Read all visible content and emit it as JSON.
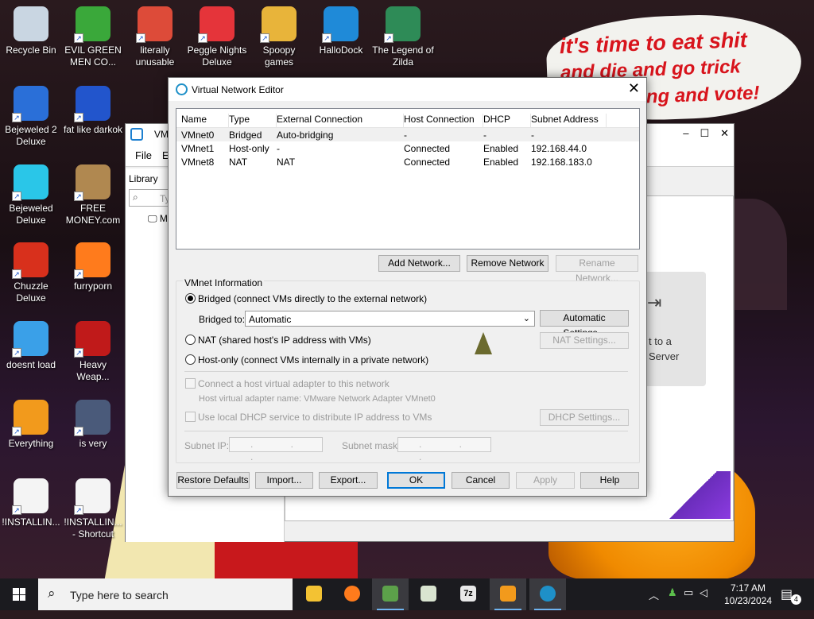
{
  "desktop": {
    "bubble": {
      "line1": "it's time to eat shit",
      "line2": "and die and go trick",
      "line3": "ing and vote!"
    },
    "icons": [
      {
        "label": "Recycle Bin",
        "color": "#c9d6e2"
      },
      {
        "label": "EVIL GREEN MEN CO...",
        "color": "#3aa83a"
      },
      {
        "label": "literally unusable",
        "color": "#dd4b39"
      },
      {
        "label": "Peggle Nights Deluxe",
        "color": "#e5343a"
      },
      {
        "label": "Spoopy games",
        "color": "#e8b43a"
      },
      {
        "label": "HalloDock",
        "color": "#1f8ad8"
      },
      {
        "label": "The Legend of Zilda",
        "color": "#2e8b57"
      },
      {
        "label": "Bejeweled 2 Deluxe",
        "color": "#2a6fd8"
      },
      {
        "label": "fat like darkok",
        "color": "#2255cc"
      },
      {
        "label": "Bejeweled Deluxe",
        "color": "#2ac6e8"
      },
      {
        "label": "FREE MONEY.com",
        "color": "#b08850"
      },
      {
        "label": "Chuzzle Deluxe",
        "color": "#d8301c"
      },
      {
        "label": "furryporn",
        "color": "#ff7b1c"
      },
      {
        "label": "doesnt load",
        "color": "#3aa0e8"
      },
      {
        "label": "Heavy Weap...",
        "color": "#c01a1a"
      },
      {
        "label": "Everything",
        "color": "#f29a1c"
      },
      {
        "label": "is very",
        "color": "#4a5a7a"
      },
      {
        "label": "!INSTALLIN...",
        "color": "#f4f4f4"
      },
      {
        "label": "!INSTALLIN... - Shortcut",
        "color": "#f4f4f4"
      }
    ]
  },
  "bg_window": {
    "title": "VMware Workstation",
    "title_visible": "VM",
    "menu": [
      "File",
      "Ed"
    ],
    "library_label": "Library",
    "search_placeholder": "Typ",
    "tree_item": "M",
    "card_text_1": "t to a",
    "card_text_2": "Server",
    "controls": [
      "–",
      "☐",
      "✕"
    ]
  },
  "dialog": {
    "title": "Virtual Network Editor",
    "columns": [
      "Name",
      "Type",
      "External Connection",
      "Host Connection",
      "DHCP",
      "Subnet Address"
    ],
    "rows": [
      {
        "name": "VMnet0",
        "type": "Bridged",
        "external": "Auto-bridging",
        "host": "-",
        "dhcp": "-",
        "subnet": "-"
      },
      {
        "name": "VMnet1",
        "type": "Host-only",
        "external": "-",
        "host": "Connected",
        "dhcp": "Enabled",
        "subnet": "192.168.44.0"
      },
      {
        "name": "VMnet8",
        "type": "NAT",
        "external": "NAT",
        "host": "Connected",
        "dhcp": "Enabled",
        "subnet": "192.168.183.0"
      }
    ],
    "add_network": "Add Network...",
    "remove_network": "Remove Network",
    "rename_network": "Rename Network...",
    "vmnet_info_label": "VMnet Information",
    "bridged_label": "Bridged (connect VMs directly to the external network)",
    "bridged_to_label": "Bridged to:",
    "bridged_to_value": "Automatic",
    "automatic_settings": "Automatic Settings...",
    "nat_label": "NAT (shared host's IP address with VMs)",
    "nat_settings": "NAT Settings...",
    "hostonly_label": "Host-only (connect VMs internally in a private network)",
    "connect_adapter_label": "Connect a host virtual adapter to this network",
    "adapter_name_label": "Host virtual adapter name: VMware Network Adapter VMnet0",
    "dhcp_label": "Use local DHCP service to distribute IP address to VMs",
    "dhcp_settings": "DHCP Settings...",
    "subnet_ip_label": "Subnet IP:",
    "subnet_mask_label": "Subnet mask:",
    "ip_dots": ". . .",
    "restore_defaults": "Restore Defaults",
    "import": "Import...",
    "export": "Export...",
    "ok": "OK",
    "cancel": "Cancel",
    "apply": "Apply",
    "help": "Help"
  },
  "taskbar": {
    "search_placeholder": "Type here to search",
    "time": "7:17 AM",
    "date": "10/23/2024",
    "notification_count": "4",
    "apps": [
      "file-explorer",
      "firefox",
      "winamp",
      "task-manager",
      "7zip",
      "vmware",
      "network"
    ]
  }
}
